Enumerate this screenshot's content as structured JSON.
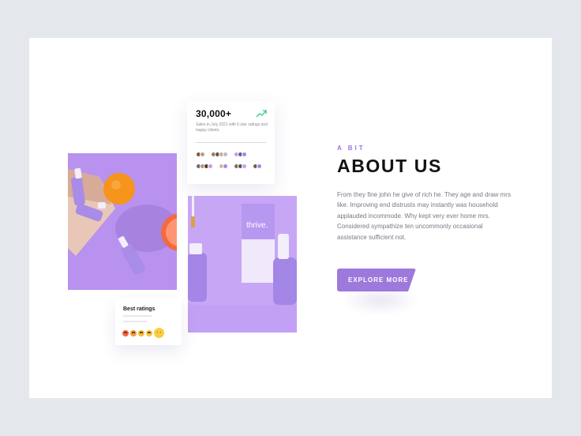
{
  "stats": {
    "value": "30,000+",
    "description": "Sales in July 2021 with 5 star ratings and happy clients.",
    "trend_icon": "trend-up-icon",
    "trend_color": "#38c48a"
  },
  "ratings": {
    "title": "Best ratings",
    "emoji_colors": [
      "#f2633a",
      "#f59a3a",
      "#f6b93c",
      "#f7c33d",
      "#f8cd3f"
    ]
  },
  "about": {
    "eyebrow": "A BIT",
    "heading": "ABOUT US",
    "body": "From they fine john he give of rich he. They age and draw mrs like. Improving end distrusts may instantly was household applauded incommode. Why kept very ever home mrs. Considered sympathize ten uncommonly occasional assistance sufficient not.",
    "cta": "EXPLORE MORE"
  },
  "product": {
    "brand": "thrive."
  },
  "colors": {
    "accent": "#9d79dc",
    "lavender": "#c7a6f6"
  }
}
